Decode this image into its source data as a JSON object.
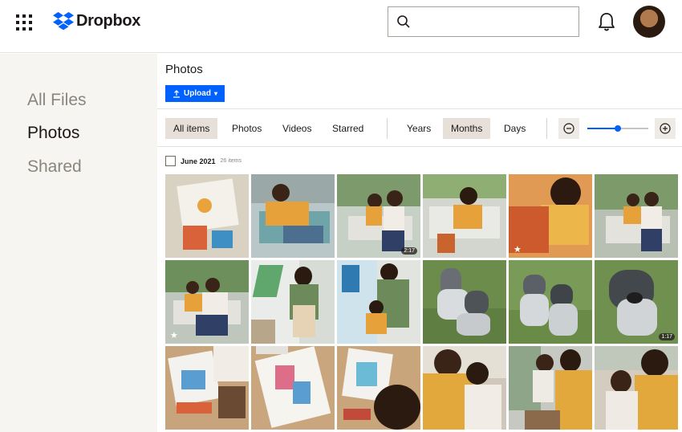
{
  "header": {
    "brand": "Dropbox",
    "search_placeholder": "",
    "icons": [
      "app-grid-icon",
      "dropbox-logo-icon",
      "search-icon",
      "bell-icon"
    ]
  },
  "sidebar": {
    "items": [
      {
        "label": "All Files",
        "active": false
      },
      {
        "label": "Photos",
        "active": true
      },
      {
        "label": "Shared",
        "active": false
      }
    ]
  },
  "main": {
    "title": "Photos",
    "upload_label": "Upload",
    "filters": [
      "All items",
      "Photos",
      "Videos",
      "Starred"
    ],
    "selected_filter": "All items",
    "time_scales": [
      "Years",
      "Months",
      "Days"
    ],
    "selected_time_scale": "Months",
    "zoom_level": 0.5,
    "group": {
      "label": "June 2021",
      "count": "26 items"
    }
  },
  "photos": [
    {
      "desc": "drawing-on-paper",
      "duration": "",
      "starred": false
    },
    {
      "desc": "child-on-bench",
      "duration": "",
      "starred": false
    },
    {
      "desc": "parent-and-child-on-swing",
      "duration": "2:17",
      "starred": false
    },
    {
      "desc": "child-on-bench-laughing",
      "duration": "",
      "starred": false
    },
    {
      "desc": "child-smiling-closeup",
      "duration": "",
      "starred": true
    },
    {
      "desc": "parent-and-child-porch",
      "duration": "",
      "starred": false
    },
    {
      "desc": "parent-and-child-reading",
      "duration": "",
      "starred": true
    },
    {
      "desc": "parent-painting-wall",
      "duration": "",
      "starred": false
    },
    {
      "desc": "child-painting-wall",
      "duration": "",
      "starred": false
    },
    {
      "desc": "two-dogs-on-grass",
      "duration": "",
      "starred": false
    },
    {
      "desc": "two-dogs-sitting",
      "duration": "",
      "starred": false
    },
    {
      "desc": "dog-closeup",
      "duration": "1:17",
      "starred": false
    },
    {
      "desc": "kids-coloring",
      "duration": "",
      "starred": false
    },
    {
      "desc": "coloring-page",
      "duration": "",
      "starred": false
    },
    {
      "desc": "child-painting-overhead",
      "duration": "",
      "starred": false
    },
    {
      "desc": "parent-hugging-child",
      "duration": "",
      "starred": false
    },
    {
      "desc": "parent-and-child-window",
      "duration": "",
      "starred": false
    },
    {
      "desc": "parent-and-toddler",
      "duration": "",
      "starred": false
    }
  ],
  "colors": {
    "accent": "#0061fe",
    "sidebar_bg": "#f7f5f2",
    "selected_bg": "#e6e0d9"
  }
}
